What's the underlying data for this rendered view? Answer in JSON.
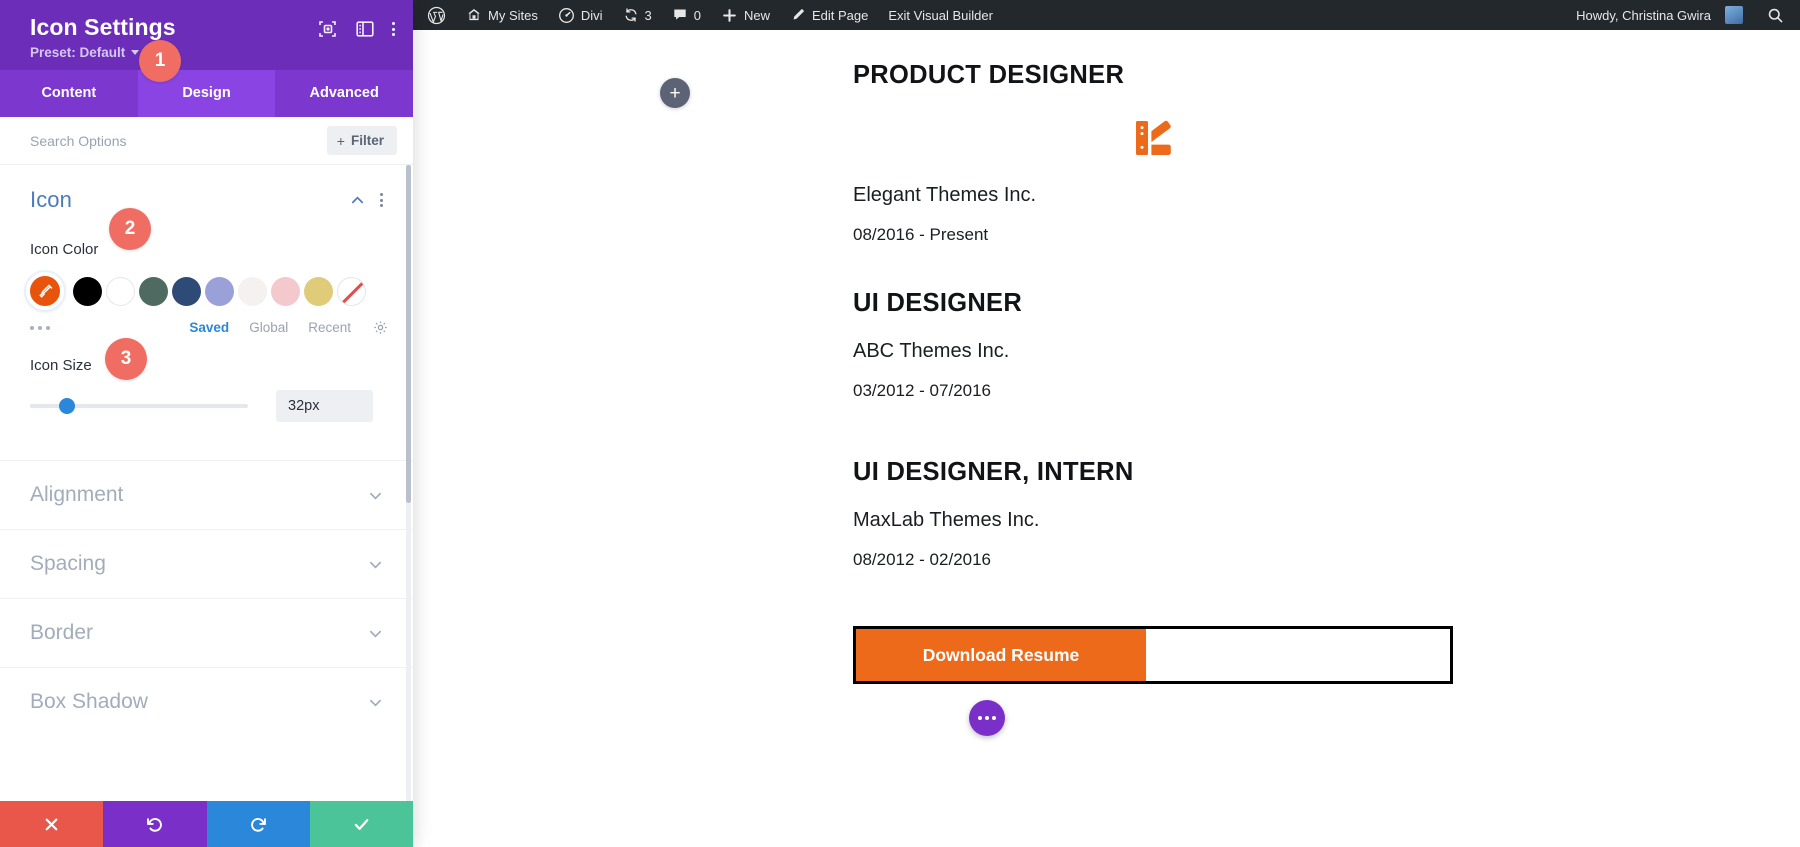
{
  "settings_panel": {
    "title": "Icon Settings",
    "preset_label": "Preset: Default",
    "header_icons": [
      {
        "name": "focus-frame-icon"
      },
      {
        "name": "layout-panel-icon"
      },
      {
        "name": "kebab-menu-icon"
      }
    ],
    "tabs": [
      {
        "label": "Content",
        "active": false
      },
      {
        "label": "Design",
        "active": true
      },
      {
        "label": "Advanced",
        "active": false
      }
    ],
    "search": {
      "placeholder": "Search Options",
      "value": ""
    },
    "filter_button": "Filter",
    "open_section": {
      "title": "Icon",
      "fields": {
        "icon_color": {
          "label": "Icon Color",
          "selected_color": "#E8540C",
          "swatches": [
            "#000000",
            "#FFFFFF",
            "#4F6A60",
            "#2E4A77",
            "#9AA0D8",
            "#F4F1F0",
            "#F3C9CD",
            "#E0CB79"
          ],
          "none_swatch_label": "no-color",
          "palette_tabs": [
            {
              "label": "Saved",
              "selected": true
            },
            {
              "label": "Global",
              "selected": false
            },
            {
              "label": "Recent",
              "selected": false
            }
          ]
        },
        "icon_size": {
          "label": "Icon Size",
          "value": "32px",
          "slider_percent": 17
        }
      }
    },
    "closed_sections": [
      {
        "label": "Alignment"
      },
      {
        "label": "Spacing"
      },
      {
        "label": "Border"
      },
      {
        "label": "Box Shadow"
      }
    ],
    "footer_buttons": [
      {
        "name": "cancel-changes-button",
        "icon": "close-x-icon",
        "color": "#E9574B"
      },
      {
        "name": "undo-button",
        "icon": "undo-arrow-icon",
        "color": "#7B2FC9"
      },
      {
        "name": "redo-button",
        "icon": "redo-arrow-icon",
        "color": "#2B87DA"
      },
      {
        "name": "save-changes-button",
        "icon": "checkmark-icon",
        "color": "#4BC49A"
      }
    ],
    "step_badges": [
      "1",
      "2",
      "3"
    ]
  },
  "admin_bar": {
    "items": [
      {
        "label": "",
        "icon": "wordpress-logo-icon"
      },
      {
        "label": "My Sites",
        "icon": "home-multisite-icon"
      },
      {
        "label": "Divi",
        "icon": "divi-gauge-icon"
      },
      {
        "label": "3",
        "icon": "updates-refresh-icon"
      },
      {
        "label": "0",
        "icon": "comment-bubble-icon"
      },
      {
        "label": "New",
        "icon": "plus-icon"
      },
      {
        "label": "Edit Page",
        "icon": "pencil-edit-icon"
      },
      {
        "label": "Exit Visual Builder",
        "icon": ""
      }
    ],
    "howdy": "Howdy, Christina Gwira",
    "avatar": "user-avatar",
    "search_icon": "search-icon"
  },
  "canvas": {
    "add_section_label": "+",
    "resume_entries": [
      {
        "title": "PRODUCT DESIGNER",
        "company": "Elegant Themes Inc.",
        "dates": "08/2016 - Present",
        "has_icon": true,
        "icon": "color-palette-swatch-icon",
        "icon_color": "#ED6A1A"
      },
      {
        "title": "UI DESIGNER",
        "company": "ABC Themes Inc.",
        "dates": "03/2012 - 07/2016",
        "has_icon": false
      },
      {
        "title": "UI DESIGNER, INTERN",
        "company": "MaxLab Themes Inc.",
        "dates": "08/2012 - 02/2016",
        "has_icon": false
      }
    ],
    "download_button": "Download Resume",
    "module_menu_icon": "ellipsis-module-settings-icon"
  }
}
